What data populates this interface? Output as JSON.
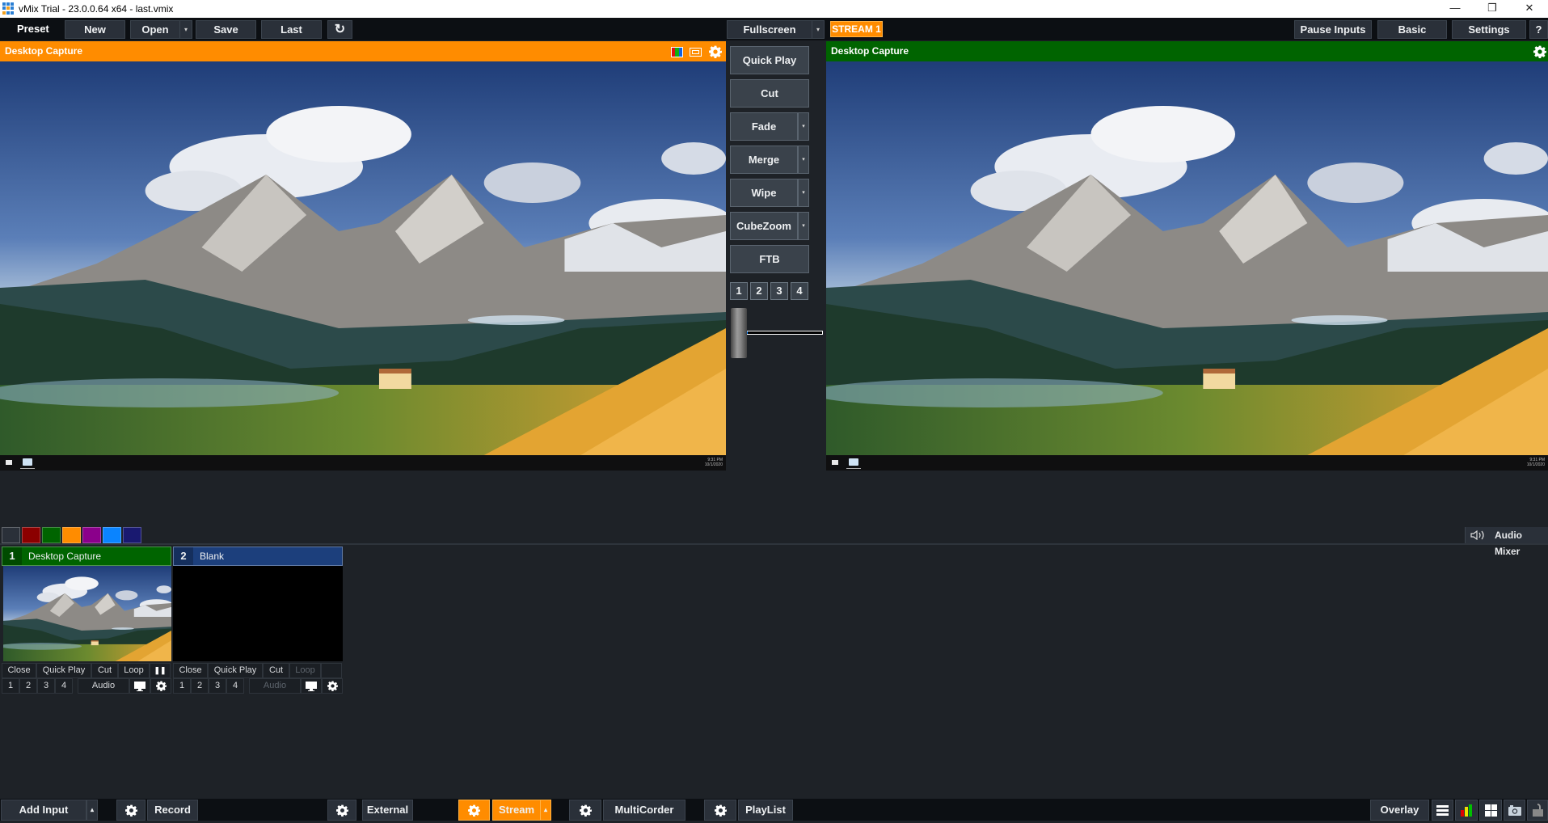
{
  "window": {
    "title": "vMix Trial - 23.0.0.64 x64 - last.vmix",
    "minimize_glyph": "—",
    "restore_glyph": "❐",
    "close_glyph": "✕"
  },
  "toolbar": {
    "preset_label": "Preset",
    "new_label": "New",
    "open_label": "Open",
    "save_label": "Save",
    "last_label": "Last",
    "refresh_glyph": "↻",
    "fullscreen_label": "Fullscreen",
    "dropdown_glyph": "▾",
    "stream_badge": "STREAM 1",
    "pause_inputs_label": "Pause Inputs",
    "basic_label": "Basic",
    "settings_label": "Settings",
    "help_label": "?"
  },
  "preview": {
    "title": "Desktop Capture",
    "header_color": "#ff8c00",
    "clock_time": "9:31 PM",
    "clock_date": "10/1/2020"
  },
  "output": {
    "title": "Desktop Capture",
    "header_color": "#006400",
    "clock_time": "9:31 PM",
    "clock_date": "10/1/2020"
  },
  "transitions": {
    "quick_play": "Quick Play",
    "cut": "Cut",
    "fade": "Fade",
    "merge": "Merge",
    "wipe": "Wipe",
    "cubezoom": "CubeZoom",
    "ftb": "FTB",
    "numbers": [
      "1",
      "2",
      "3",
      "4"
    ],
    "tbar_position_percent": 0
  },
  "color_tabs": [
    "#2a3039",
    "#8b0000",
    "#006400",
    "#ff8c00",
    "#8b008b",
    "#0a84ff",
    "#191970"
  ],
  "audio_mixer": {
    "label": "Audio Mixer",
    "icon": "speaker-icon"
  },
  "inputs": [
    {
      "number": "1",
      "name": "Desktop Capture",
      "header_color": "#006400",
      "buttons_row1": [
        "Close",
        "Quick Play",
        "Cut",
        "Loop"
      ],
      "pause_glyph": "❚❚",
      "buttons_row2": [
        "1",
        "2",
        "3",
        "4"
      ],
      "audio_label": "Audio",
      "audio_enabled": true,
      "loop_enabled": true
    },
    {
      "number": "2",
      "name": "Blank",
      "header_color": "#1c3f7c",
      "buttons_row1": [
        "Close",
        "Quick Play",
        "Cut",
        "Loop"
      ],
      "buttons_row2": [
        "1",
        "2",
        "3",
        "4"
      ],
      "audio_label": "Audio",
      "audio_enabled": false,
      "loop_enabled": false
    }
  ],
  "bottombar": {
    "add_input_label": "Add Input",
    "up_glyph": "▴",
    "record_label": "Record",
    "external_label": "External",
    "stream_label": "Stream",
    "multicorder_label": "MultiCorder",
    "playlist_label": "PlayList",
    "overlay_label": "Overlay",
    "accent_color": "#ff8c00"
  }
}
